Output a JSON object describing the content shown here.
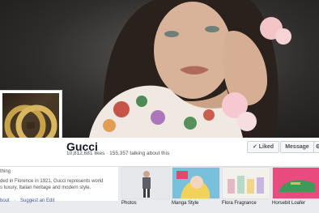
{
  "page": {
    "name": "Gucci",
    "stats": "10,812,681 likes · 155,357 talking about this"
  },
  "actions": {
    "like_label": "✓ Liked",
    "message_label": "Message",
    "more_label": "⚙"
  },
  "about": {
    "heading": "thing",
    "line1": "ded in Florence in 1921, Gucci represents world",
    "line2": "s luxury, Italian heritage and modern style."
  },
  "links": {
    "about": "bout",
    "suggest": "Suggest an Edit"
  },
  "apps": [
    {
      "label": "Photos"
    },
    {
      "label": "Manga Style"
    },
    {
      "label": "Flora Fragrance"
    },
    {
      "label": "Horsebit Loafer"
    }
  ],
  "colors": {
    "link": "#3b5998",
    "background": "#e9ebee",
    "gold": "#c7a24a"
  }
}
